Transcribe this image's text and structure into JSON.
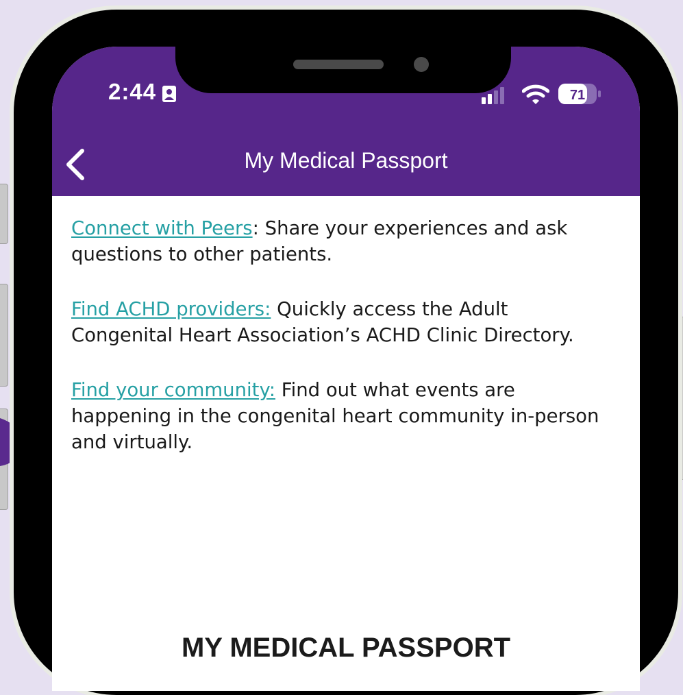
{
  "status_bar": {
    "time": "2:44",
    "battery": "71"
  },
  "nav": {
    "title": "My Medical Passport"
  },
  "content": {
    "items": [
      {
        "link": "Connect with Peers",
        "text": ": Share your experiences and ask questions to other patients."
      },
      {
        "link": "Find ACHD providers:",
        "text": " Quickly access the Adult Congenital Heart Association’s ACHD Clinic Directory."
      },
      {
        "link": "Find your community:",
        "text": " Find out what events are happening in the congenital heart community in-person and virtually."
      }
    ]
  },
  "footer": {
    "title": "MY MEDICAL PASSPORT"
  },
  "colors": {
    "brand_purple": "#56268a",
    "link_teal": "#26a0a4",
    "background": "#e6e0f1"
  },
  "icons": [
    "contact-card-icon",
    "signal-icon",
    "wifi-icon",
    "battery-icon",
    "chevron-left-icon"
  ]
}
